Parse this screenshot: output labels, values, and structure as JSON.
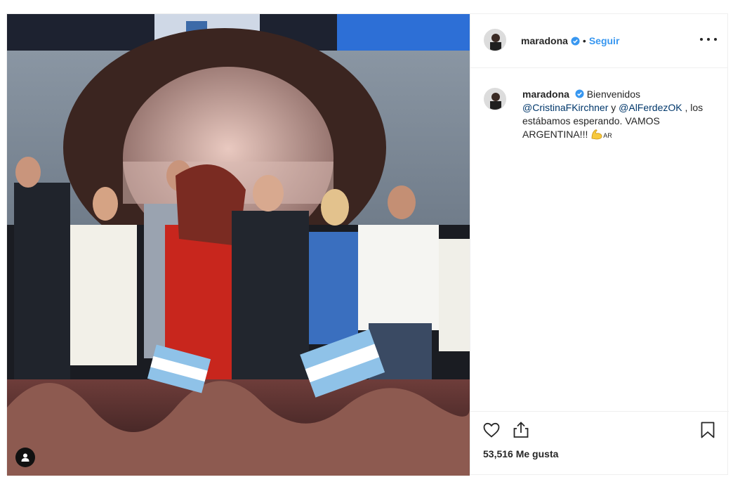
{
  "post": {
    "username": "maradona",
    "verified": true,
    "separator": "•",
    "follow_label": "Seguir",
    "more_icon": "more-horizontal-icon",
    "caption": {
      "username": "maradona",
      "text_intro": "Bienvenidos",
      "mention_1": "@CristinaFKirchner",
      "connector": "y",
      "mention_2": "@AlFerdezOK",
      "text_after_mentions": ",",
      "text_body": "los estábamos esperando. VAMOS ARGENTINA!!!",
      "emoji": "flexed-biceps-emoji",
      "flag_text": "AR"
    },
    "likes_count": "53,516",
    "likes_label": "Me gusta",
    "icons": {
      "like": "heart-icon",
      "share": "share-icon",
      "save": "bookmark-icon",
      "photo_tag": "user-tag-icon"
    },
    "colors": {
      "link": "#3897f0",
      "mention": "#00376b",
      "verified": "#3897f0"
    }
  }
}
